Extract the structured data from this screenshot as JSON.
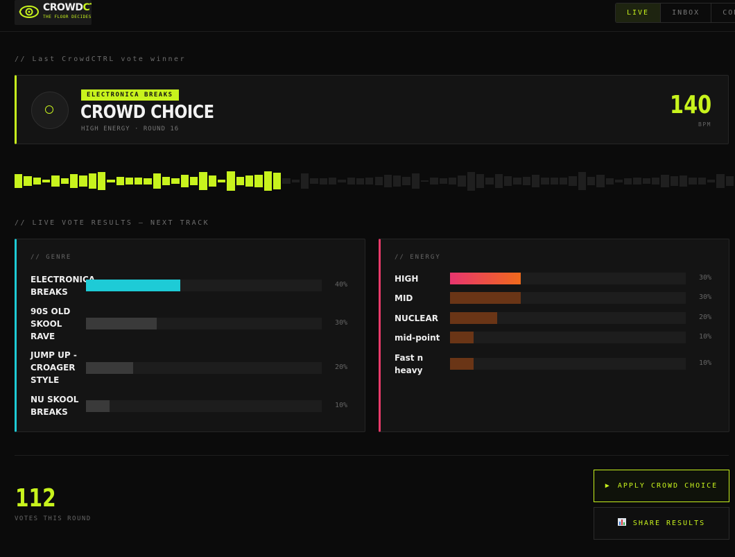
{
  "header": {
    "brand_a": "CROWD",
    "brand_b": "CTRL",
    "tagline": "THE FLOOR DECIDES",
    "tabs": [
      {
        "label": "LIVE",
        "active": true
      },
      {
        "label": "INBOX",
        "active": false
      },
      {
        "label": "CONF",
        "active": false
      }
    ]
  },
  "last_winner": {
    "section_label": "// Last CrowdCTRL vote winner",
    "genre_badge": "ELECTRONICA BREAKS",
    "title": "CROWD CHOICE",
    "subtitle": "HIGH ENERGY · ROUND 16",
    "bpm": "140",
    "bpm_label": "BPM"
  },
  "waveform": {
    "progress": 0.37,
    "active_color": "#c8f31d",
    "inactive_color": "#1f1f1f",
    "levels": [
      0.55,
      0.4,
      0.3,
      0.1,
      0.45,
      0.2,
      0.55,
      0.45,
      0.6,
      0.7,
      0.1,
      0.35,
      0.3,
      0.3,
      0.25,
      0.6,
      0.35,
      0.2,
      0.5,
      0.35,
      0.7,
      0.45,
      0.1,
      0.8,
      0.35,
      0.45,
      0.5,
      0.8,
      0.65,
      0.2,
      0.1,
      0.6,
      0.2,
      0.25,
      0.3,
      0.1,
      0.3,
      0.25,
      0.3,
      0.35,
      0.5,
      0.45,
      0.35,
      0.6,
      0.05,
      0.3,
      0.2,
      0.3,
      0.45,
      0.75,
      0.55,
      0.3,
      0.55,
      0.4,
      0.3,
      0.35,
      0.5,
      0.3,
      0.3,
      0.3,
      0.4,
      0.7,
      0.35,
      0.5,
      0.25,
      0.1,
      0.25,
      0.3,
      0.2,
      0.3,
      0.5,
      0.4,
      0.45,
      0.3,
      0.3,
      0.1,
      0.55,
      0.4
    ]
  },
  "results": {
    "section_label": "// LIVE VOTE RESULTS — NEXT TRACK",
    "genre": {
      "label": "// GENRE",
      "items": [
        {
          "name": "ELECTRONICA BREAKS",
          "pct": 40,
          "pct_label": "40%"
        },
        {
          "name": "90S OLD SKOOL RAVE",
          "pct": 30,
          "pct_label": "30%"
        },
        {
          "name": "JUMP UP - CROAGER STYLE",
          "pct": 20,
          "pct_label": "20%"
        },
        {
          "name": "NU SKOOL BREAKS",
          "pct": 10,
          "pct_label": "10%"
        }
      ]
    },
    "energy": {
      "label": "// ENERGY",
      "items": [
        {
          "name": "HIGH",
          "pct": 30,
          "pct_label": "30%"
        },
        {
          "name": "MID",
          "pct": 30,
          "pct_label": "30%"
        },
        {
          "name": "NUCLEAR",
          "pct": 20,
          "pct_label": "20%"
        },
        {
          "name": "mid-point",
          "pct": 10,
          "pct_label": "10%"
        },
        {
          "name": "Fast n heavy",
          "pct": 10,
          "pct_label": "10%"
        }
      ]
    },
    "colors": {
      "genre_leader": "#1ecbd6",
      "genre_other": "#3a3a3a",
      "energy_leader_from": "#e8356f",
      "energy_leader_to": "#f06a1c",
      "energy_other": "#6a3516"
    }
  },
  "footer": {
    "votes_count": "112",
    "votes_label": "VOTES THIS ROUND",
    "apply_icon": "play-icon",
    "apply_label": "APPLY CROWD CHOICE",
    "share_icon": "chart-icon",
    "share_label": "SHARE RESULTS"
  }
}
